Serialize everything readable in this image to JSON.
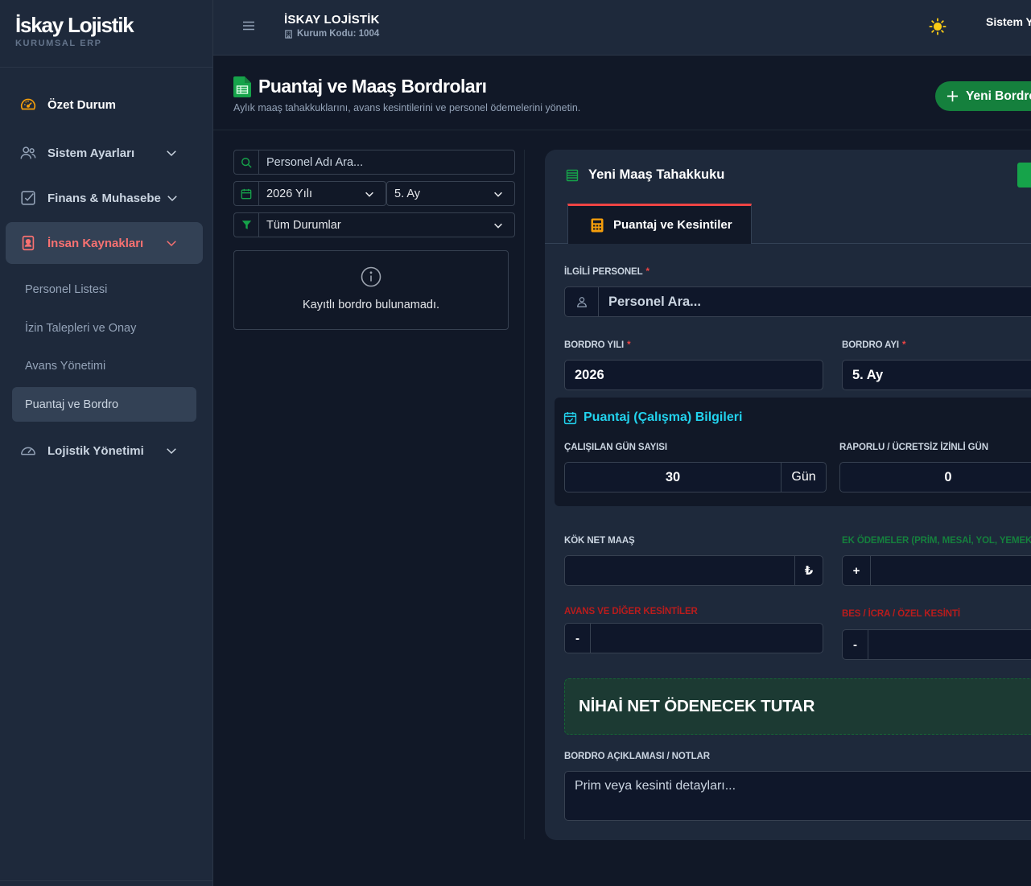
{
  "brand": {
    "title": "İskay Lojistik",
    "subtitle": "KURUMSAL ERP"
  },
  "topbar": {
    "org_name": "İSKAY LOJİSTİK",
    "org_code": "Kurum Kodu: 1004",
    "user": "Sistem Y"
  },
  "sidebar": {
    "items": [
      {
        "label": "Özet Durum",
        "icon": "gauge-icon"
      },
      {
        "label": "Sistem Ayarları",
        "icon": "users-icon"
      },
      {
        "label": "Finans & Muhasebe",
        "icon": "checkbox-icon"
      },
      {
        "label": "İnsan Kaynakları",
        "icon": "id-badge-icon"
      },
      {
        "label": "Lojistik Yönetimi",
        "icon": "speedometer-icon"
      }
    ],
    "subitems": [
      {
        "label": "Personel Listesi"
      },
      {
        "label": "İzin Talepleri ve Onay"
      },
      {
        "label": "Avans Yönetimi"
      },
      {
        "label": "Puantaj ve Bordro"
      }
    ]
  },
  "page": {
    "title": "Puantaj ve Maaş Bordroları",
    "subtitle": "Aylık maaş tahakkuklarını, avans kesintilerini ve personel ödemelerini yönetin.",
    "new_button": "Yeni Bordro"
  },
  "filters": {
    "search_placeholder": "Personel Adı Ara...",
    "year": "2026 Yılı",
    "month": "5. Ay",
    "status": "Tüm Durumlar",
    "empty_message": "Kayıtlı bordro bulunamadı."
  },
  "form": {
    "title": "Yeni Maaş Tahakkuku",
    "tab": "Puantaj ve Kesintiler",
    "personel_label": "İLGİLİ PERSONEL",
    "personel_placeholder": "Personel Ara...",
    "year_label": "BORDRO YILI",
    "year_value": "2026",
    "month_label": "BORDRO AYI",
    "month_value": "5. Ay",
    "puantaj_title": "Puantaj (Çalışma) Bilgileri",
    "worked_days_label": "ÇALIŞILAN GÜN SAYISI",
    "worked_days_value": "30",
    "worked_days_unit": "Gün",
    "leave_days_label": "RAPORLU / ÜCRETSİZ İZİNLİ GÜN",
    "leave_days_value": "0",
    "base_salary_label": "KÖK NET MAAŞ",
    "currency": "₺",
    "extra_label": "EK ÖDEMELER (PRİM, MESAİ, YOL, YEMEK)",
    "plus": "+",
    "advance_label": "AVANS VE DİĞER KESİNTİLER",
    "minus": "-",
    "bes_label": "BES / İCRA / ÖZEL KESİNTİ",
    "net_label": "NİHAİ NET ÖDENECEK TUTAR",
    "notes_label": "BORDRO AÇIKLAMASI / NOTLAR",
    "notes_placeholder": "Prim veya kesinti detayları..."
  },
  "colors": {
    "accent_red": "#f87171",
    "success_green": "#15803d",
    "cyan": "#22d3ee",
    "warning": "#f59e0b"
  }
}
